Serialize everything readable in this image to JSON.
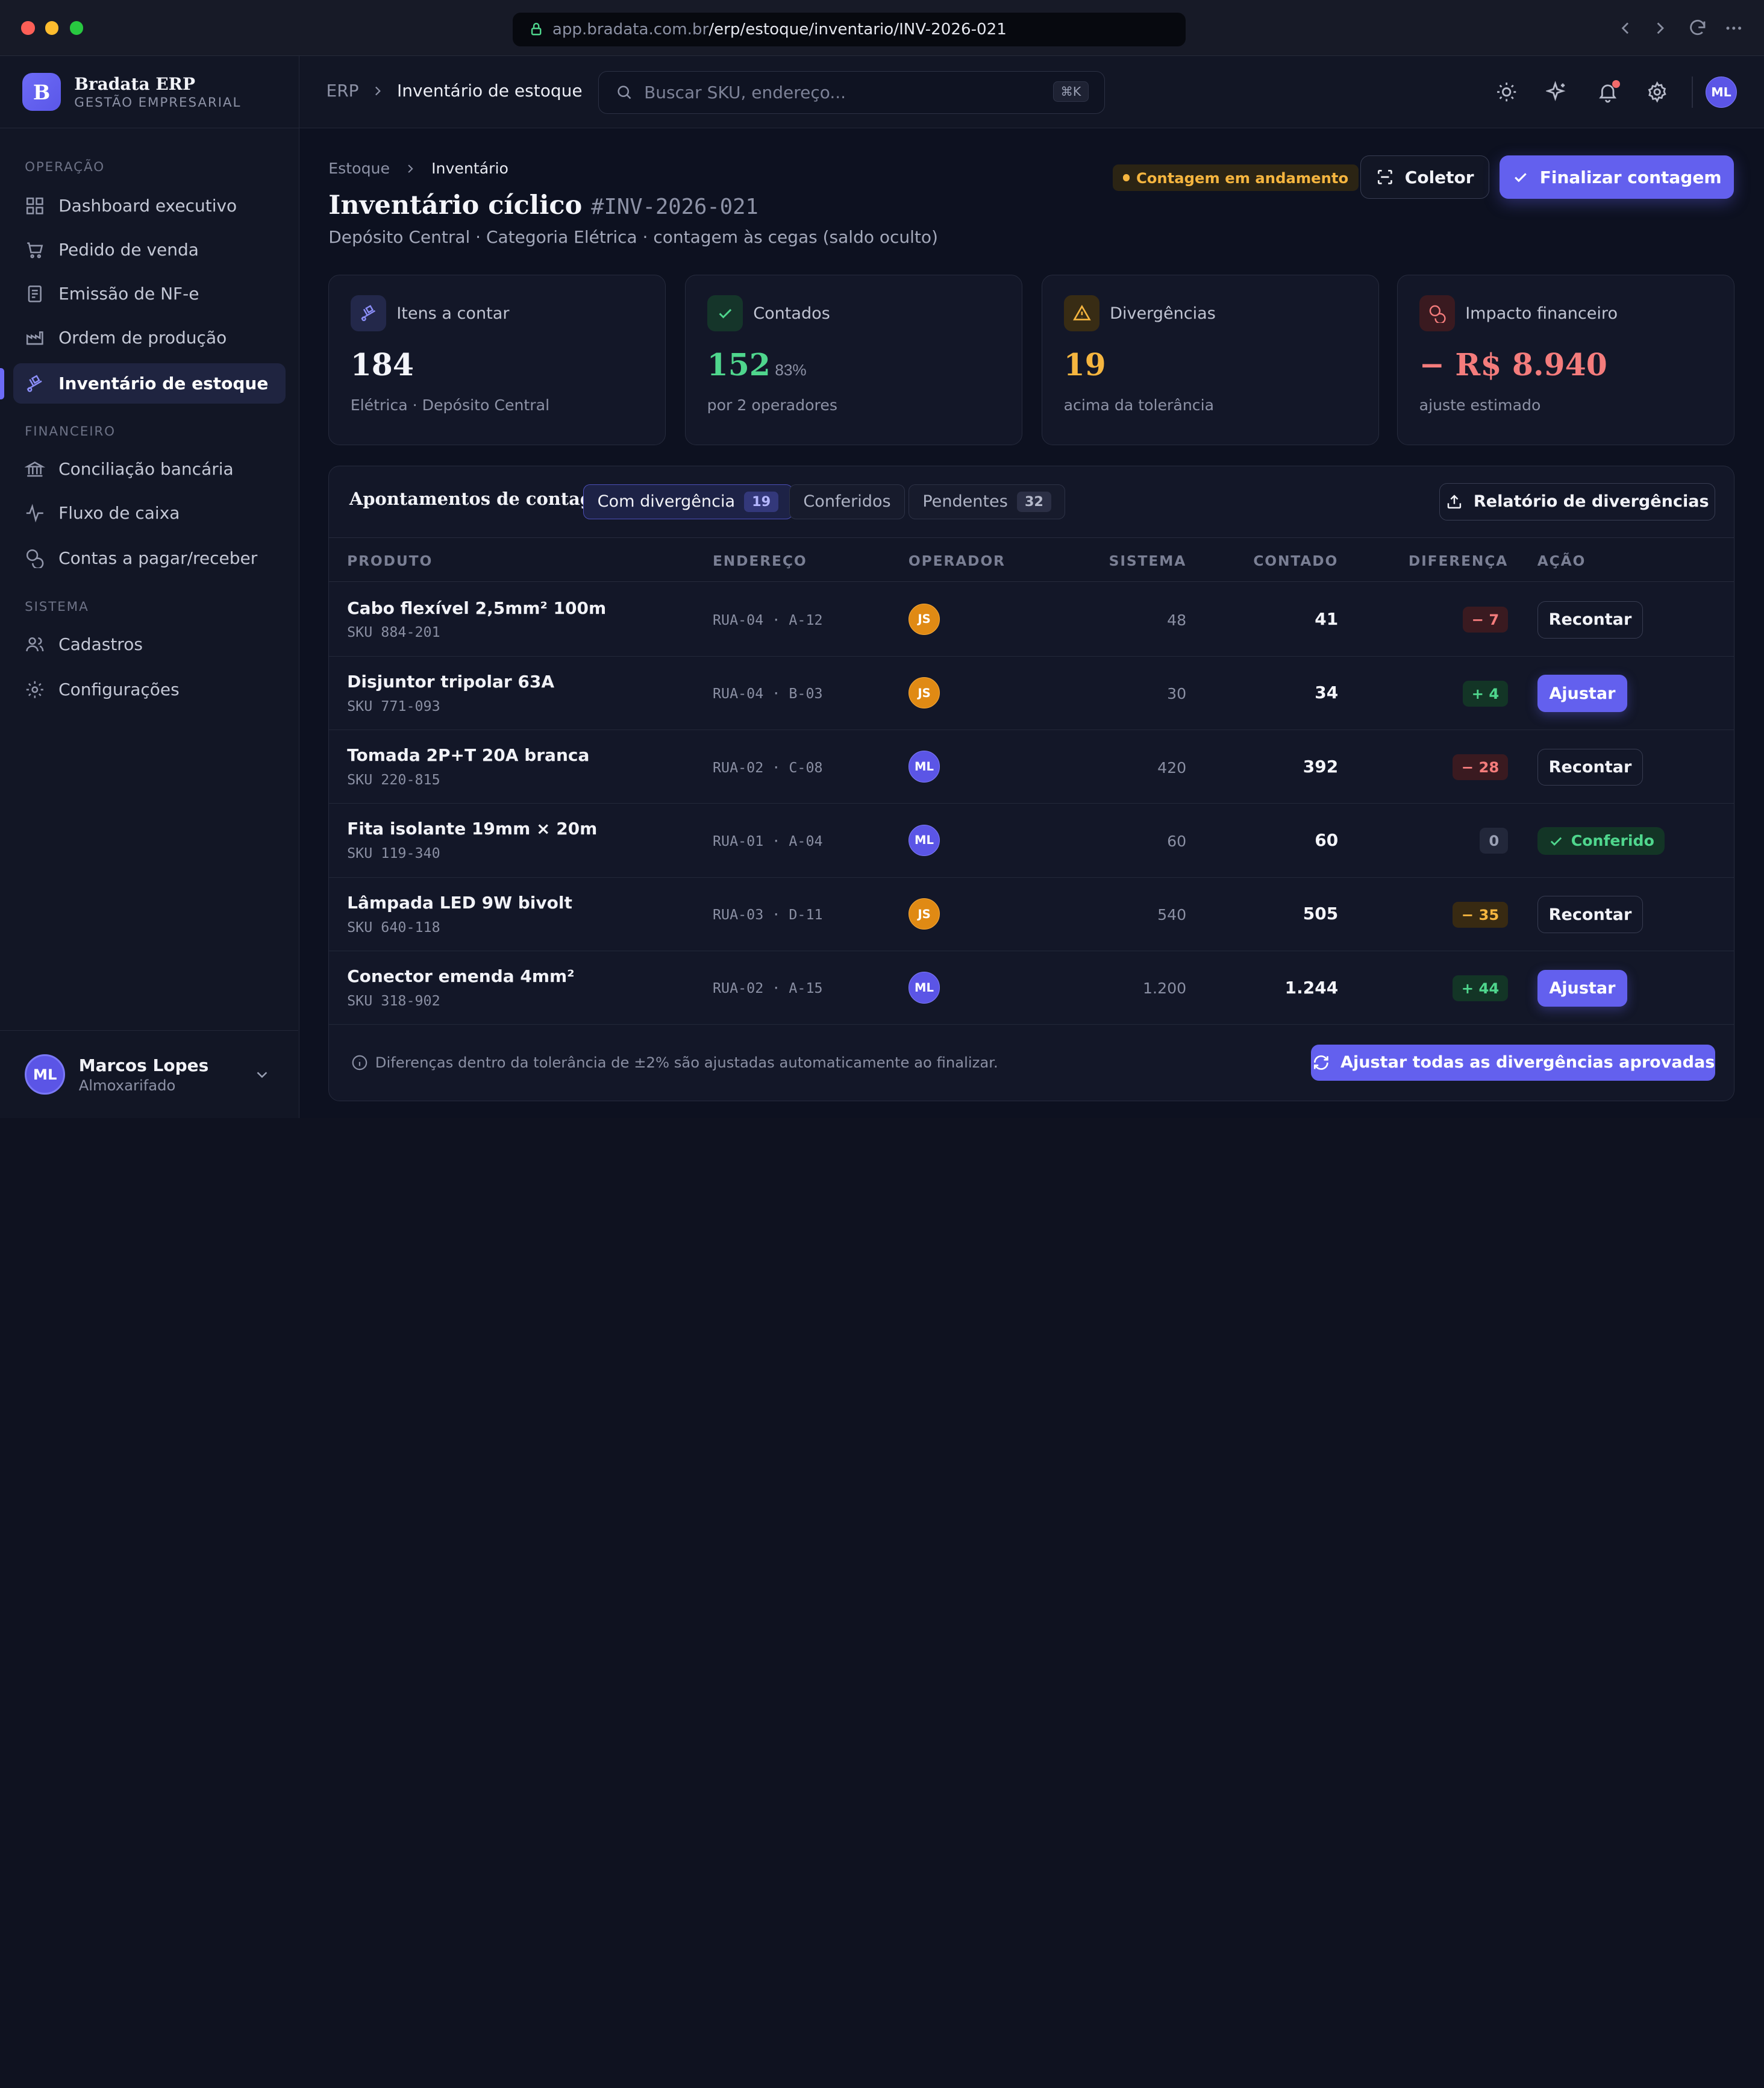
{
  "browser": {
    "url_host": "app.bradata.com.br",
    "url_path": "/erp/estoque/inventario/INV-2026-021"
  },
  "brand": {
    "name": "Bradata ERP",
    "tagline": "GESTÃO EMPRESARIAL",
    "logo_letter": "B"
  },
  "sidebar": {
    "sections": {
      "operacao": "OPERAÇÃO",
      "financeiro": "FINANCEIRO",
      "sistema": "SISTEMA"
    },
    "items": [
      {
        "label": "Dashboard executivo",
        "icon": "dashboard-icon"
      },
      {
        "label": "Pedido de venda",
        "icon": "cart-icon"
      },
      {
        "label": "Emissão de NF-e",
        "icon": "invoice-icon"
      },
      {
        "label": "Ordem de produção",
        "icon": "factory-icon"
      },
      {
        "label": "Inventário de estoque",
        "icon": "dolly-icon",
        "active": true
      },
      {
        "label": "Conciliação bancária",
        "icon": "bank-icon"
      },
      {
        "label": "Fluxo de caixa",
        "icon": "pulse-icon"
      },
      {
        "label": "Contas a pagar/receber",
        "icon": "coins-icon"
      },
      {
        "label": "Cadastros",
        "icon": "users-icon"
      },
      {
        "label": "Configurações",
        "icon": "gear-icon"
      }
    ],
    "user": {
      "initials": "ML",
      "name": "Marcos Lopes",
      "role": "Almoxarifado"
    }
  },
  "header": {
    "breadcrumb_root": "ERP",
    "breadcrumb_current": "Inventário de estoque",
    "search_placeholder": "Buscar SKU, endereço...",
    "search_shortcut": "⌘K",
    "avatar_initials": "ML"
  },
  "page": {
    "breadcrumb": [
      "Estoque",
      "Inventário"
    ],
    "title": "Inventário cíclico",
    "code": "#INV-2026-021",
    "subtitle": "Depósito Central · Categoria Elétrica · contagem às cegas (saldo oculto)",
    "status": "Contagem em andamento",
    "collector_label": "Coletor",
    "finalize_label": "Finalizar contagem"
  },
  "kpis": [
    {
      "label": "Itens a contar",
      "value": "184",
      "extra": "",
      "foot": "Elétrica · Depósito Central",
      "color": "#f4f5fa"
    },
    {
      "label": "Contados",
      "value": "152",
      "extra": "83%",
      "foot": "por 2 operadores",
      "color": "#4fd68d"
    },
    {
      "label": "Divergências",
      "value": "19",
      "extra": "",
      "foot": "acima da tolerância",
      "color": "#f5b53f"
    },
    {
      "label": "Impacto financeiro",
      "value": "− R$ 8.940",
      "extra": "",
      "foot": "ajuste estimado",
      "color": "#f47c7c"
    }
  ],
  "panel": {
    "title": "Apontamentos de contagem",
    "tabs": [
      {
        "label": "Com divergência",
        "count": "19",
        "active": true
      },
      {
        "label": "Conferidos",
        "count": ""
      },
      {
        "label": "Pendentes",
        "count": "32"
      }
    ],
    "report_label": "Relatório de divergências",
    "columns": [
      "PRODUTO",
      "ENDEREÇO",
      "OPERADOR",
      "SISTEMA",
      "CONTADO",
      "DIFERENÇA",
      "AÇÃO"
    ],
    "rows": [
      {
        "name": "Cabo flexível 2,5mm² 100m",
        "sku": "SKU 884-201",
        "address": "RUA-04 · A-12",
        "operator": "JS",
        "system": "48",
        "counted": "41",
        "diff": "− 7",
        "diff_type": "neg",
        "action": "Recontar",
        "action_type": "recount"
      },
      {
        "name": "Disjuntor tripolar 63A",
        "sku": "SKU 771-093",
        "address": "RUA-04 · B-03",
        "operator": "JS",
        "system": "30",
        "counted": "34",
        "diff": "+ 4",
        "diff_type": "pos",
        "action": "Ajustar",
        "action_type": "adjust"
      },
      {
        "name": "Tomada 2P+T 20A branca",
        "sku": "SKU 220-815",
        "address": "RUA-02 · C-08",
        "operator": "ML",
        "system": "420",
        "counted": "392",
        "diff": "− 28",
        "diff_type": "neg",
        "action": "Recontar",
        "action_type": "recount"
      },
      {
        "name": "Fita isolante 19mm × 20m",
        "sku": "SKU 119-340",
        "address": "RUA-01 · A-04",
        "operator": "ML",
        "system": "60",
        "counted": "60",
        "diff": "0",
        "diff_type": "zero",
        "action": "Conferido",
        "action_type": "ok"
      },
      {
        "name": "Lâmpada LED 9W bivolt",
        "sku": "SKU 640-118",
        "address": "RUA-03 · D-11",
        "operator": "JS",
        "system": "540",
        "counted": "505",
        "diff": "− 35",
        "diff_type": "warn",
        "action": "Recontar",
        "action_type": "recount"
      },
      {
        "name": "Conector emenda 4mm²",
        "sku": "SKU 318-902",
        "address": "RUA-02 · A-15",
        "operator": "ML",
        "system": "1.200",
        "counted": "1.244",
        "diff": "+ 44",
        "diff_type": "pos",
        "action": "Ajustar",
        "action_type": "adjust"
      }
    ],
    "footer_note": "Diferenças dentro da tolerância de ±2% são ajustadas automaticamente ao finalizar.",
    "bulk_label": "Ajustar todas as divergências aprovadas"
  },
  "colors": {
    "accent": "#6360ee",
    "warning": "#f5b53f",
    "success": "#4fd68d",
    "danger": "#f47c7c"
  }
}
